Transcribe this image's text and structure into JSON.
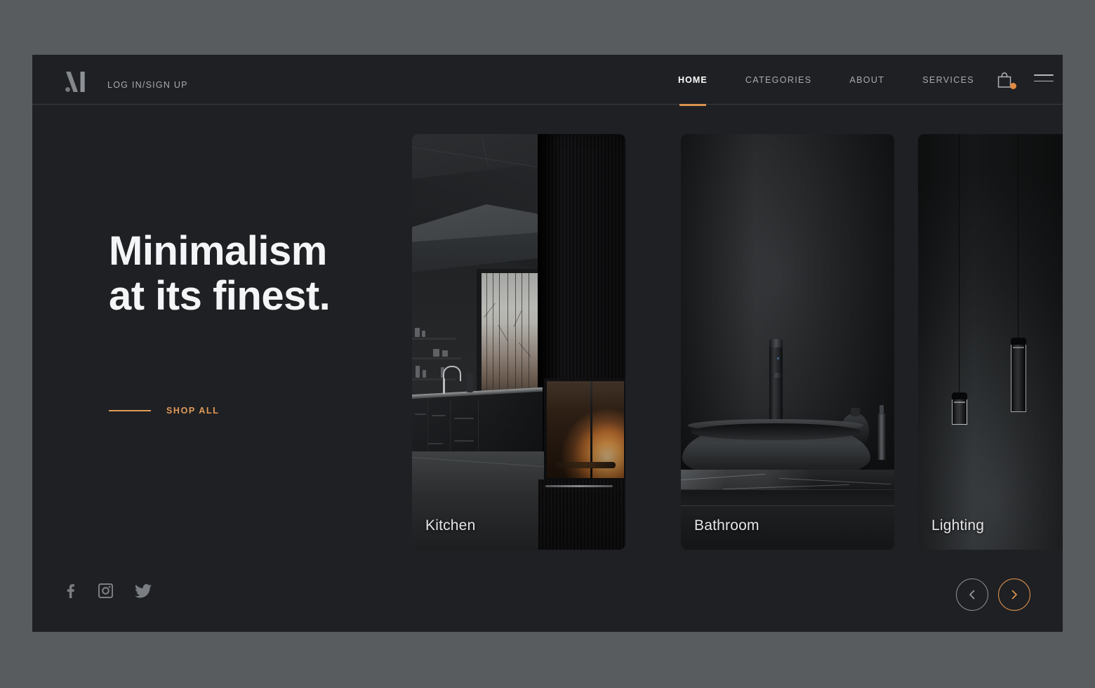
{
  "theme": {
    "page_background": "#585c5e",
    "surface_background": "#1e2023",
    "accent": "#e0944d",
    "text_primary": "#f4f5f6",
    "text_muted": "#a9acb0"
  },
  "header": {
    "logo_name": "M",
    "logo_alt": "monogram-m-logo",
    "auth_link": "LOG IN/SIGN UP",
    "nav_items": [
      {
        "label": "HOME",
        "active": true
      },
      {
        "label": "CATEGORIES",
        "active": false
      },
      {
        "label": "ABOUT",
        "active": false
      },
      {
        "label": "SERVICES",
        "active": false
      }
    ],
    "cart_icon": "shopping-bag-icon",
    "cart_badge_color": "#e08c46",
    "menu_icon": "hamburger-menu-icon"
  },
  "hero": {
    "headline_line1": "Minimalism",
    "headline_line2": "at its finest.",
    "cta_label": "SHOP ALL"
  },
  "carousel": {
    "cards": [
      {
        "label": "Kitchen",
        "scene": "dark-kitchen-with-fireplace"
      },
      {
        "label": "Bathroom",
        "scene": "black-vessel-sink-basin"
      },
      {
        "label": "Lighting",
        "scene": "three-black-pendant-lamps"
      }
    ],
    "prev_icon": "chevron-left-icon",
    "next_icon": "chevron-right-icon"
  },
  "footer": {
    "socials": [
      {
        "name": "facebook-icon"
      },
      {
        "name": "instagram-icon"
      },
      {
        "name": "twitter-icon"
      }
    ]
  }
}
